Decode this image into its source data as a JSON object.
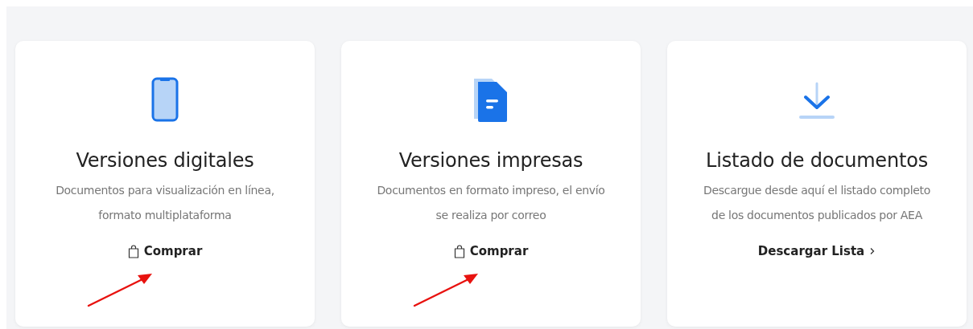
{
  "cards": [
    {
      "kind": "phone",
      "title": "Versiones digitales",
      "description": [
        "Documentos para visualización en línea,",
        "formato multiplataforma"
      ],
      "action": {
        "kind": "buy",
        "label": "Comprar"
      },
      "arrow": true
    },
    {
      "kind": "document",
      "title": "Versiones impresas",
      "description": [
        "Documentos en formato impreso, el envío",
        "se realiza por correo"
      ],
      "action": {
        "kind": "buy",
        "label": "Comprar"
      },
      "arrow": true
    },
    {
      "kind": "download",
      "title": "Listado de documentos",
      "description": [
        "Descargue desde aquí el listado completo",
        "de los documentos publicados por AEA"
      ],
      "action": {
        "kind": "download",
        "label": "Descargar Lista"
      },
      "arrow": false
    }
  ]
}
